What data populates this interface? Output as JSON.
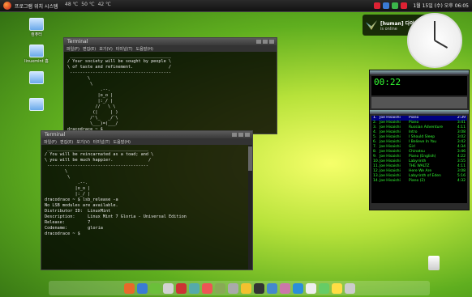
{
  "top_panel": {
    "menu_text": "프로그램  위치  시스템",
    "indicators": [
      "48 ℃",
      "50 ℃",
      "42 ℃"
    ],
    "clock": "1월 15일 (수) 오후 06:05"
  },
  "desktop_icons": [
    {
      "label": "컴퓨터"
    },
    {
      "label": "linuxmint 홈"
    },
    {
      "label": ""
    },
    {
      "label": ""
    }
  ],
  "notification": {
    "title": "[human] 다이아트",
    "subtitle": "is online"
  },
  "terminal1": {
    "title": "Terminal",
    "menu": [
      "파일(F)",
      "편집(E)",
      "보기(V)",
      "터미널(T)",
      "도움말(H)"
    ],
    "lines": [
      " ________________________________________",
      "/ Your society will be sought by people \\",
      "\\ of taste and refinement.              /",
      " ----------------------------------------",
      "        \\",
      "         \\",
      "             .--.",
      "            |o_o |",
      "            |:_/ |",
      "           //   \\ \\",
      "          (|     | )",
      "         /'\\_   _/`\\",
      "         \\___)=(___/",
      "dracodrace ~ $ "
    ]
  },
  "terminal2": {
    "title": "Terminal",
    "menu": [
      "파일(F)",
      "편집(E)",
      "보기(V)",
      "터미널(T)",
      "도움말(H)"
    ],
    "lines": [
      " ________________________________________",
      "/ You will be reincarnated as a toad; and \\",
      "\\ you will be much happier.              /",
      " ----------------------------------------",
      "        \\",
      "         \\",
      "             .--.",
      "            |o_o |",
      "            |:_/ |",
      "dracodrace ~ $ lsb_release -a",
      "No LSB modules are available.",
      "Distributor ID:  LinuxMint",
      "Description:     Linux Mint 7 Gloria - Universal Edition",
      "Release:         7",
      "Codename:        gloria",
      "dracodrace ~ $ "
    ]
  },
  "player": {
    "time": "00:22",
    "playlist": [
      {
        "n": "1.",
        "a": "Joe Hisaishi",
        "s": "Piano",
        "d": "2:39"
      },
      {
        "n": "2.",
        "a": "Joe Hisaishi",
        "s": "Piano",
        "d": "3:41"
      },
      {
        "n": "3.",
        "a": "Joe Hisaishi",
        "s": "Russian Adventure",
        "d": "4:11"
      },
      {
        "n": "4.",
        "a": "Joe Hisaishi",
        "s": "Intro",
        "d": "3:08"
      },
      {
        "n": "5.",
        "a": "Joe Hisaishi",
        "s": "I Should Sleep",
        "d": "3:02"
      },
      {
        "n": "6.",
        "a": "Joe Hisaishi",
        "s": "I Believe In You",
        "d": "3:42"
      },
      {
        "n": "7.",
        "a": "Joe Hisaishi",
        "s": "Girl",
        "d": "4:34"
      },
      {
        "n": "8.",
        "a": "Joe Hisaishi",
        "s": "Chinatsu",
        "d": "3:46"
      },
      {
        "n": "9.",
        "a": "Joe Hisaishi",
        "s": "Piano (English)",
        "d": "4:22"
      },
      {
        "n": "10.",
        "a": "Joe Hisaishi",
        "s": "Labyrinth",
        "d": "3:55"
      },
      {
        "n": "11.",
        "a": "Joe Hisaishi",
        "s": "THE WALTZ",
        "d": "4:11"
      },
      {
        "n": "12.",
        "a": "Joe Hisaishi",
        "s": "Here We Are",
        "d": "3:08"
      },
      {
        "n": "13.",
        "a": "Joe Hisaishi",
        "s": "Labyrinth of Eden",
        "d": "5:16"
      },
      {
        "n": "14.",
        "a": "Joe Hisaishi",
        "s": "Piano (2)",
        "d": "4:32"
      }
    ]
  },
  "dock_icons": [
    "firefox-icon",
    "browser-icon",
    "files-icon",
    "edit-icon",
    "pdf-icon",
    "chat-icon",
    "mail-icon",
    "music-icon",
    "settings-icon",
    "photo-icon",
    "terminal-icon",
    "media-icon",
    "video-icon",
    "globe-icon",
    "calendar-icon",
    "network-icon",
    "weather-icon",
    "trash-icon"
  ],
  "colors": {
    "terminal_bg": "#000000",
    "player_text": "#33ff33",
    "accent_green": "#8ed12a"
  }
}
